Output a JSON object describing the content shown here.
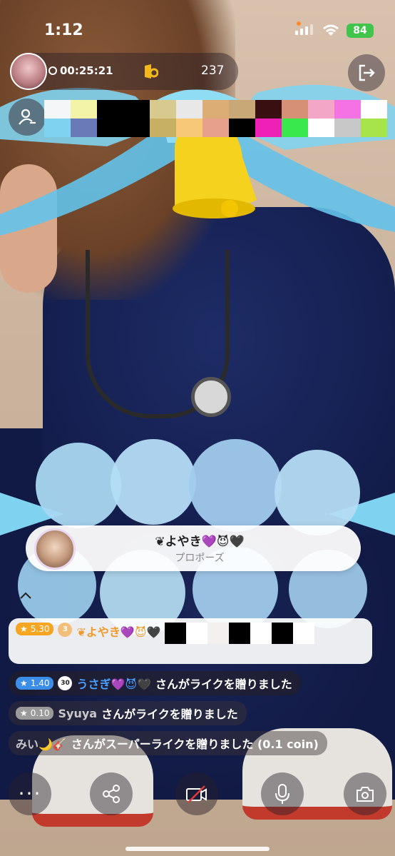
{
  "status": {
    "time": "1:12",
    "battery": "84"
  },
  "header": {
    "timer": "00:25:21",
    "viewer_count": "237"
  },
  "gift_card": {
    "sender": "❦よやき💜😈🖤",
    "gift": "プロポーズ"
  },
  "chat": [
    {
      "badge": "5.30",
      "name": "❦よやき💜😈🖤",
      "rank": "3"
    },
    {
      "badge": "1.40",
      "days": "30",
      "name": "うさぎ💜😈🖤",
      "message": "さんがライクを贈りました"
    },
    {
      "badge": "0.10",
      "name": "Syuya",
      "message": "さんがライクを贈りました"
    },
    {
      "name": "みい🌙🎸",
      "message": "さんがスーパーライクを贈りました (0.1 coin)"
    }
  ],
  "colors": {
    "accent": "#f09a2a",
    "battery": "#40c44c",
    "blue_name": "#4aa0ff"
  },
  "icons": [
    "clock-icon",
    "coin-icon",
    "exit-icon",
    "follow-icon",
    "more-icon",
    "share-icon",
    "camera-off-icon",
    "microphone-icon",
    "camera-flip-icon",
    "chevron-up-icon"
  ]
}
